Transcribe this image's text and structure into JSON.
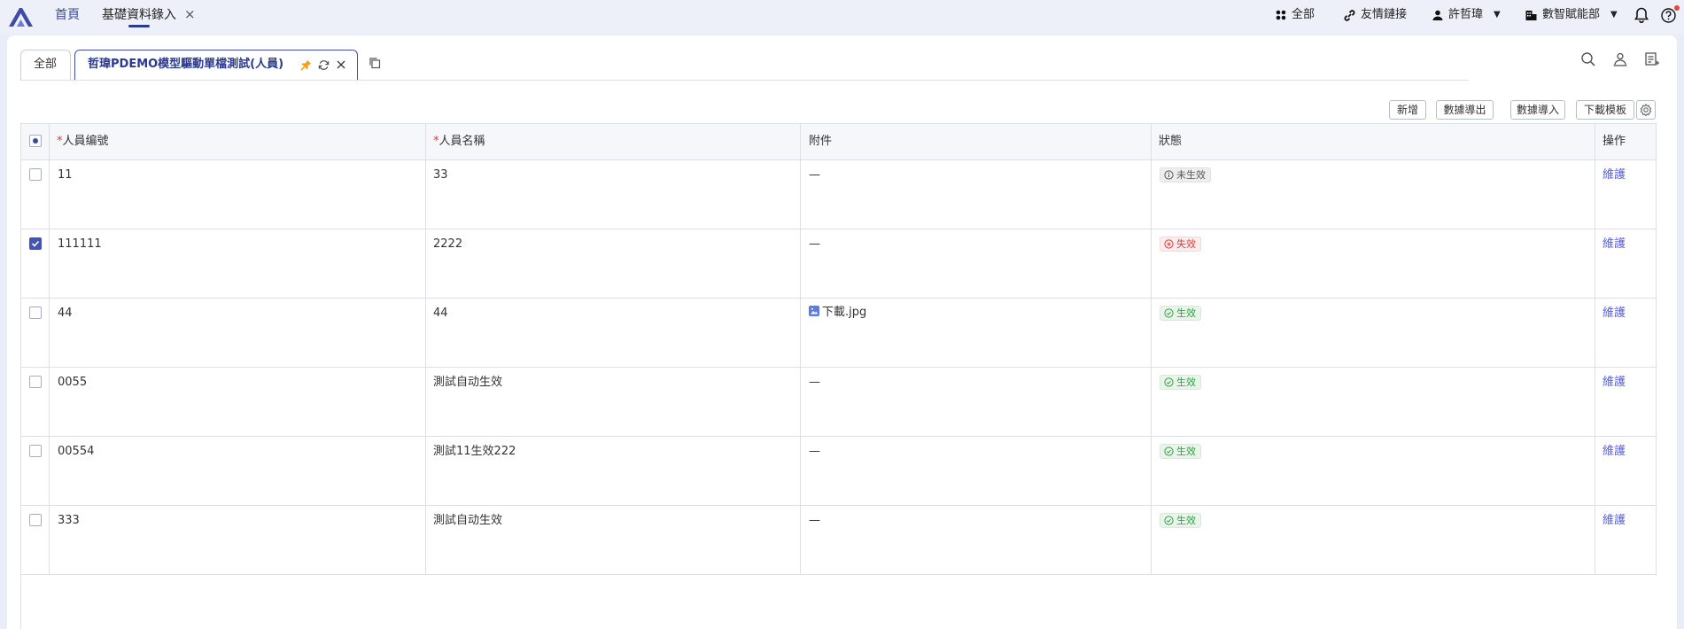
{
  "topbar": {
    "tabs": [
      {
        "label": "首頁"
      },
      {
        "label": "基礎資料錄入"
      }
    ],
    "close_glyph": "×",
    "right_items": [
      {
        "label": "全部",
        "icon": "apps-icon"
      },
      {
        "label": "友情鏈接",
        "icon": "link-icon"
      },
      {
        "label": "許哲瑋",
        "icon": "user-icon"
      },
      {
        "label": "數智賦能部",
        "icon": "building-icon"
      }
    ],
    "caret": "▼"
  },
  "page_tabs": {
    "all_label": "全部",
    "active_label": "哲瑋PDEMO模型驅動單檔測試(人員)"
  },
  "actions": {
    "add": "新增",
    "export": "數據導出",
    "import": "數據導入",
    "template": "下載模板"
  },
  "table": {
    "columns": [
      {
        "label": "人員编號",
        "required": "*"
      },
      {
        "label": "人員名稱",
        "required": "*"
      },
      {
        "label": "附件"
      },
      {
        "label": "狀態"
      },
      {
        "label": "操作"
      }
    ],
    "rows": [
      {
        "code": "11",
        "name": "33",
        "attachment": "—",
        "status": "未生效",
        "status_type": "gray",
        "action": "維護",
        "checked": false
      },
      {
        "code": "111111",
        "name": "2222",
        "attachment": "—",
        "status": "失效",
        "status_type": "red",
        "action": "維護",
        "checked": true
      },
      {
        "code": "44",
        "name": "44",
        "attachment": "下載.jpg",
        "status": "生效",
        "status_type": "green",
        "action": "維護",
        "checked": false
      },
      {
        "code": "0055",
        "name": "測試自动生效",
        "attachment": "—",
        "status": "生效",
        "status_type": "green",
        "action": "維護",
        "checked": false
      },
      {
        "code": "00554",
        "name": "測試11生效222",
        "attachment": "—",
        "status": "生效",
        "status_type": "green",
        "action": "維護",
        "checked": false
      },
      {
        "code": "333",
        "name": "測試自动生效",
        "attachment": "—",
        "status": "生效",
        "status_type": "green",
        "action": "維護",
        "checked": false
      }
    ]
  },
  "colors": {
    "accent": "#2b3a8f",
    "link": "#5a5fd6",
    "danger": "#e03a3a",
    "success": "#2f9e44"
  }
}
